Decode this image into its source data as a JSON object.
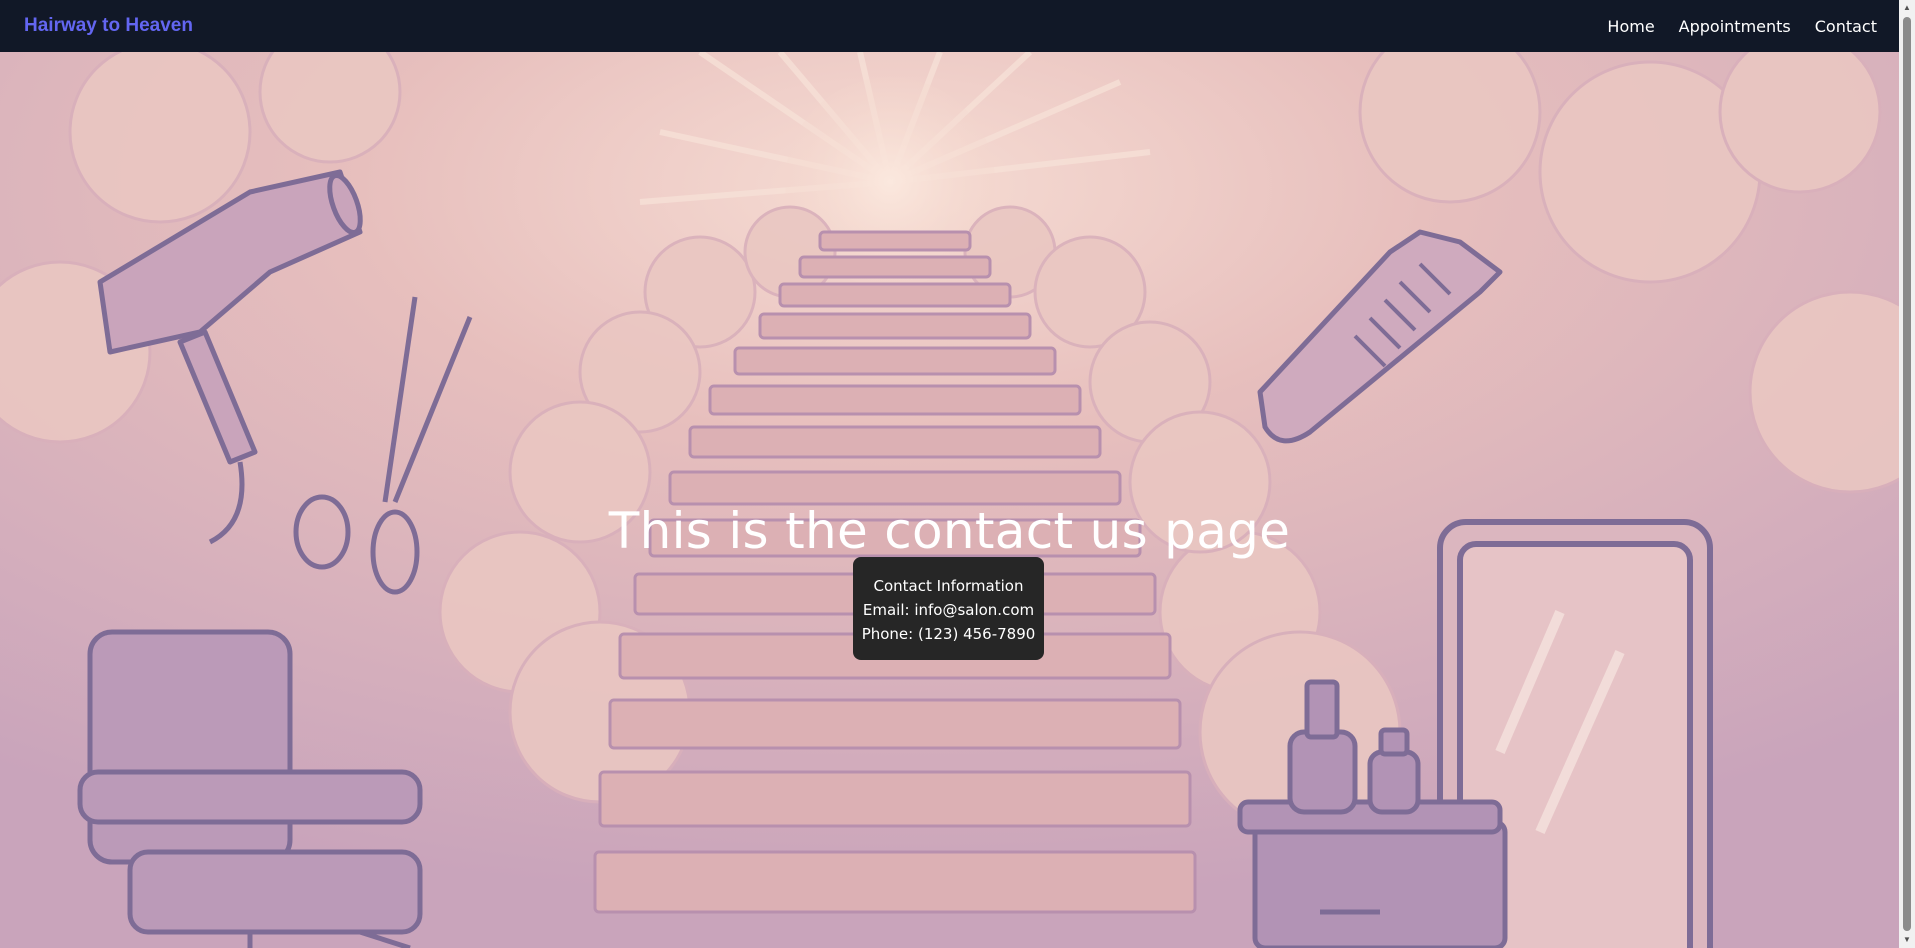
{
  "navbar": {
    "brand": "Hairway to Heaven",
    "links": [
      "Home",
      "Appointments",
      "Contact"
    ],
    "brand_color": "#6366f1",
    "background": "#111827"
  },
  "hero": {
    "headline": "This is the contact us page",
    "background_description_icons": [
      "hair-dryer-icon",
      "scissors-icon",
      "comb-icon",
      "salon-chair-icon",
      "mirror-icon",
      "spray-bottle-icon",
      "stairway-illustration",
      "sun-rays-illustration"
    ]
  },
  "tooltip": {
    "title": "Contact Information",
    "email": "Email: info@salon.com",
    "phone": "Phone: (123) 456-7890",
    "background": "#262626"
  },
  "scrollbar": {
    "up_arrow": "▲",
    "down_arrow": "▼"
  }
}
